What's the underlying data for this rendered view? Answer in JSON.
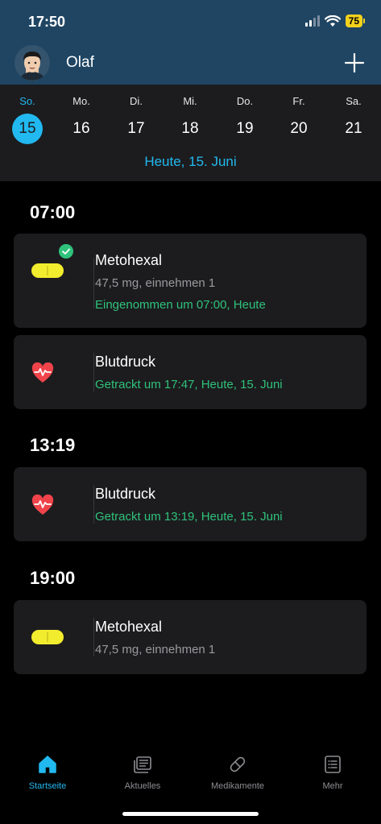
{
  "status_bar": {
    "time": "17:50",
    "battery": "75"
  },
  "header": {
    "user_name": "Olaf"
  },
  "week": {
    "days": [
      {
        "name": "So.",
        "num": "15",
        "selected": true
      },
      {
        "name": "Mo.",
        "num": "16"
      },
      {
        "name": "Di.",
        "num": "17"
      },
      {
        "name": "Mi.",
        "num": "18"
      },
      {
        "name": "Do.",
        "num": "19"
      },
      {
        "name": "Fr.",
        "num": "20"
      },
      {
        "name": "Sa.",
        "num": "21"
      }
    ],
    "today_label": "Heute, 15. Juni"
  },
  "schedule": [
    {
      "time": "07:00",
      "entries": [
        {
          "icon": "pill-icon",
          "title": "Metohexal",
          "subtitle": "47,5 mg, einnehmen 1",
          "status": "Eingenommen um 07:00, Heute",
          "checked": true
        },
        {
          "icon": "heart-pulse-icon",
          "title": "Blutdruck",
          "status": "Getrackt um 17:47, Heute, 15. Juni"
        }
      ]
    },
    {
      "time": "13:19",
      "entries": [
        {
          "icon": "heart-pulse-icon",
          "title": "Blutdruck",
          "status": "Getrackt um 13:19, Heute, 15. Juni"
        }
      ]
    },
    {
      "time": "19:00",
      "entries": [
        {
          "icon": "pill-icon",
          "title": "Metohexal",
          "subtitle": "47,5 mg, einnehmen 1"
        }
      ]
    }
  ],
  "tabs": [
    {
      "label": "Startseite",
      "icon": "home-icon",
      "active": true
    },
    {
      "label": "Aktuelles",
      "icon": "news-icon"
    },
    {
      "label": "Medikamente",
      "icon": "capsule-icon"
    },
    {
      "label": "Mehr",
      "icon": "list-icon"
    }
  ],
  "colors": {
    "accent": "#21b9f0",
    "header_bg": "#1f4563",
    "success": "#2fc27b",
    "pill": "#f2ec2e",
    "heart": "#f0434a"
  }
}
